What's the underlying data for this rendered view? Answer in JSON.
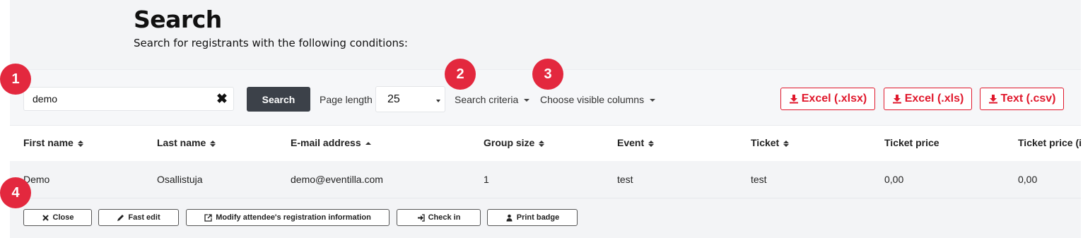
{
  "header": {
    "title": "Search",
    "subtitle": "Search for registrants with the following conditions:"
  },
  "search": {
    "value": "demo",
    "button_label": "Search",
    "page_length_label": "Page length",
    "page_length_value": "25",
    "criteria_label": "Search criteria",
    "columns_label": "Choose visible columns"
  },
  "exports": [
    {
      "label": "Excel (.xlsx)"
    },
    {
      "label": "Excel (.xls)"
    },
    {
      "label": "Text (.csv)"
    }
  ],
  "table": {
    "columns": [
      {
        "label": "First name",
        "sort": "both"
      },
      {
        "label": "Last name",
        "sort": "both"
      },
      {
        "label": "E-mail address",
        "sort": "asc"
      },
      {
        "label": "Group size",
        "sort": "both"
      },
      {
        "label": "Event",
        "sort": "both"
      },
      {
        "label": "Ticket",
        "sort": "both"
      },
      {
        "label": "Ticket price",
        "sort": "none"
      },
      {
        "label": "Ticket price (i",
        "sort": "none"
      }
    ],
    "rows": [
      [
        "Demo",
        "Osallistuja",
        "demo@eventilla.com",
        "1",
        "test",
        "test",
        "0,00",
        "0,00"
      ]
    ]
  },
  "actions": [
    {
      "label": "Close",
      "icon": "close-icon"
    },
    {
      "label": "Fast edit",
      "icon": "pencil-icon"
    },
    {
      "label": "Modify attendee's registration information",
      "icon": "external-link-icon"
    },
    {
      "label": "Check in",
      "icon": "sign-in-icon"
    },
    {
      "label": "Print badge",
      "icon": "user-icon"
    }
  ],
  "callouts": [
    "1",
    "2",
    "3",
    "4"
  ],
  "colors": {
    "accent": "#e0182c",
    "callout": "#e3283e",
    "primary_button": "#3c4149",
    "background": "#f3f4f6"
  }
}
